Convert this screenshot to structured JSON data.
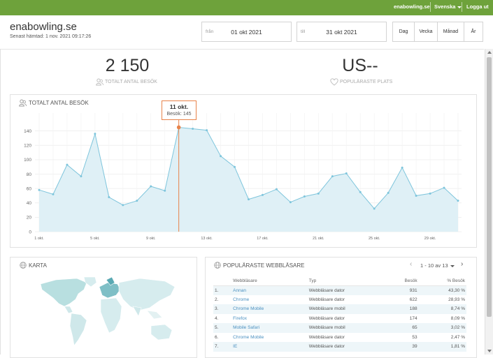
{
  "topbar": {
    "site": "enabowling.se",
    "language": "Svenska",
    "logout": "Logga ut"
  },
  "header": {
    "title": "enabowling.se",
    "subtitle": "Senast hämtad: 1 nov. 2021 09:17:26"
  },
  "date_range": {
    "from_label": "från",
    "from_value": "01 okt 2021",
    "to_label": "till",
    "to_value": "31 okt 2021"
  },
  "period_buttons": [
    "Dag",
    "Vecka",
    "Månad",
    "År"
  ],
  "kpis": {
    "visits_value": "2 150",
    "visits_label": "TOTALT ANTAL BESÖK",
    "place_value": "US--",
    "place_label": "POPULÄRASTE PLATS"
  },
  "chart_panel": {
    "title": "TOTALT ANTAL BESÖK"
  },
  "tooltip": {
    "title": "11 okt.",
    "text": "Besök: 145"
  },
  "chart_data": {
    "type": "area",
    "title": "TOTALT ANTAL BESÖK",
    "x": [
      "1 okt.",
      "2 okt.",
      "3 okt.",
      "4 okt.",
      "5 okt.",
      "6 okt.",
      "7 okt.",
      "8 okt.",
      "9 okt.",
      "10 okt.",
      "11 okt.",
      "12 okt.",
      "13 okt.",
      "14 okt.",
      "15 okt.",
      "16 okt.",
      "17 okt.",
      "18 okt.",
      "19 okt.",
      "20 okt.",
      "21 okt.",
      "22 okt.",
      "23 okt.",
      "24 okt.",
      "25 okt.",
      "26 okt.",
      "27 okt.",
      "28 okt.",
      "29 okt.",
      "30 okt.",
      "31 okt."
    ],
    "tick_labels": [
      "1 okt.",
      "5 okt.",
      "9 okt.",
      "13 okt.",
      "17 okt.",
      "21 okt.",
      "25 okt.",
      "29 okt."
    ],
    "tick_indices": [
      0,
      4,
      8,
      12,
      16,
      20,
      24,
      28
    ],
    "series": [
      {
        "values": [
          58,
          52,
          93,
          77,
          136,
          48,
          37,
          43,
          63,
          57,
          145,
          143,
          141,
          105,
          90,
          45,
          51,
          59,
          41,
          49,
          53,
          77,
          81,
          55,
          32,
          54,
          89,
          50,
          53,
          61,
          43
        ]
      }
    ],
    "yticks": [
      0,
      20,
      40,
      60,
      80,
      100,
      120,
      140
    ],
    "ylim": [
      0,
      160
    ],
    "highlight_index": 10,
    "line_color": "#7ec5dc",
    "fill_color": "#dff0f6",
    "highlight_color": "#e8834a",
    "grid": true
  },
  "map_panel": {
    "title": "KARTA"
  },
  "browsers_panel": {
    "title": "POPULÄRASTE WEBBLÄSARE",
    "pager": "1 - 10 av 13",
    "columns": [
      "Webbläsare",
      "Typ",
      "Besök",
      "% Besök"
    ],
    "rows": [
      {
        "n": "1.",
        "name": "Annan",
        "type": "Webbläsare dator",
        "visits": "931",
        "pct": "43,30 %"
      },
      {
        "n": "2.",
        "name": "Chrome",
        "type": "Webbläsare dator",
        "visits": "622",
        "pct": "28,93 %"
      },
      {
        "n": "3.",
        "name": "Chrome Mobile",
        "type": "Webbläsare mobil",
        "visits": "188",
        "pct": "8,74 %"
      },
      {
        "n": "4.",
        "name": "Firefox",
        "type": "Webbläsare dator",
        "visits": "174",
        "pct": "8,09 %"
      },
      {
        "n": "5.",
        "name": "Mobile Safari",
        "type": "Webbläsare mobil",
        "visits": "65",
        "pct": "3,02 %"
      },
      {
        "n": "6.",
        "name": "Chrome Mobile",
        "type": "Webbläsare dator",
        "visits": "53",
        "pct": "2,47 %"
      },
      {
        "n": "7.",
        "name": "IE",
        "type": "Webbläsare dator",
        "visits": "39",
        "pct": "1,81 %"
      }
    ]
  },
  "colors": {
    "topbar": "#6ea23b",
    "accent": "#e8834a",
    "line": "#7ec5dc"
  }
}
